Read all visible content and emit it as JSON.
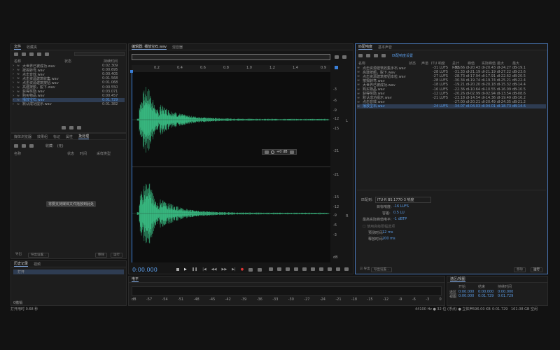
{
  "files_panel": {
    "tabs": [
      "文件",
      "收藏夹"
    ],
    "columns": [
      "名称",
      "状态",
      "持续时间"
    ],
    "files": [
      {
        "name": "大世界已被成功.wav",
        "duration": "0:02.309"
      },
      {
        "name": "按揭转弯.wav",
        "duration": "0:00.695"
      },
      {
        "name": "点击音效.wav",
        "duration": "0:00.405"
      },
      {
        "name": "点击资源建筑收集.wav",
        "duration": "0:01.568"
      },
      {
        "name": "点击资源建筑按钮.wav",
        "duration": "0:01.068"
      },
      {
        "name": "高建按额，脱下.wav",
        "duration": "0:00.550"
      },
      {
        "name": "获得奖励.wav",
        "duration": "0:03.071"
      },
      {
        "name": "购买物品.wav",
        "duration": "0:00.457"
      },
      {
        "name": "播放宝石.wav",
        "duration": "0:01.729",
        "selected": true
      },
      {
        "name": "默认成功提示.wav",
        "duration": "0:01.382"
      }
    ]
  },
  "browser_panel": {
    "tabs": [
      "媒体浏览器",
      "效果组",
      "标记",
      "属性",
      "批处理"
    ],
    "collection_label": "收藏:",
    "collection_value": "(无)",
    "columns": [
      "名称",
      "状态",
      "时间",
      "采样类型"
    ],
    "drop_hint": "将要支持媒体文件拖放到此处",
    "bottom_left": [
      "导出",
      "导出设置..."
    ],
    "bottom_right": [
      "移除",
      "运行"
    ]
  },
  "history_panel": {
    "tabs": [
      "历史记录",
      "视频"
    ],
    "items": [
      "打开"
    ],
    "status": "0撤销"
  },
  "editor": {
    "tabs": [
      "编辑器: 播放宝石.wav",
      "混音器"
    ],
    "ruler": [
      "0.2",
      "0.4",
      "0.6",
      "0.8",
      "1.0",
      "1.2",
      "1.4"
    ],
    "ruler_end": "0.9",
    "db_ticks": [
      "-3",
      "-6",
      "-9",
      "-12",
      "-15",
      "-21",
      "-21",
      "-15",
      "-12",
      "-9",
      "-6",
      "-3",
      "dB"
    ],
    "hud_gain": "+0 dB",
    "time_display": "0:00.000",
    "channel_left": "L",
    "channel_right": "R"
  },
  "levels": {
    "title": "电平",
    "scale": [
      "dB",
      "-57",
      "-54",
      "-51",
      "-48",
      "-45",
      "-42",
      "-39",
      "-36",
      "-33",
      "-30",
      "-27",
      "-24",
      "-21",
      "-18",
      "-15",
      "-12",
      "-9",
      "-6",
      "-3",
      "0"
    ]
  },
  "match_panel": {
    "tabs": [
      "匹配响度",
      "基本声音"
    ],
    "settings_link": "匹配响度设置",
    "columns": [
      "名称",
      "状态",
      " 声道",
      "ITU 响度",
      "总计 RMS",
      "峰值",
      "实际峰值",
      "最大",
      "最大"
    ],
    "rows": [
      {
        "name": "点击资源建筑收集手石.wav",
        "itu": "-31 LUFS",
        "rms": "-32.66 dB",
        "peak": "-20.43 dB",
        "tpeak": "-20.43 dB",
        "m1": "-24.27 dB",
        "m2": "-19.1"
      },
      {
        "name": "高建按额，脱下.wav",
        "itu": "-28 LUFS",
        "rms": "-31.33 dB",
        "peak": "-21.19 dB",
        "tpeak": "-21.19 dB",
        "m1": "-27.22 dB",
        "m2": "-23.6"
      },
      {
        "name": "点击资源建筑按钮本粒.wav",
        "itu": "-27 LUFS",
        "rms": "-28.73 dB",
        "peak": "-17.94 dB",
        "tpeak": "-17.91 dB",
        "m1": "-22.62 dB",
        "m2": "-20.5"
      },
      {
        "name": "按揭转弯.wav",
        "itu": "-28 LUFS",
        "rms": "-30.34 dB",
        "peak": "-19.74 dB",
        "tpeak": "-19.74 dB",
        "m1": "-25.21 dB",
        "m2": "-22.4"
      },
      {
        "name": "大世界已被成功.wav",
        "itu": "-18 LUFS",
        "rms": "-19.21 dB",
        "peak": "-20.20 dB",
        "tpeak": "-20.18 dB",
        "m1": "-15.32 dB",
        "m2": "-14.4"
      },
      {
        "name": "购买物品.wav",
        "itu": "-16 LUFS",
        "rms": "-22.36 dB",
        "peak": "-10.64 dB",
        "tpeak": "-10.55 dB",
        "m1": "-16.09 dB",
        "m2": "-10.5"
      },
      {
        "name": "获得奖励.wav",
        "itu": "-12 LUFS",
        "rms": "-20.26 dB",
        "peak": "-02.99 dB",
        "tpeak": "-02.94 dB",
        "m1": "-13.54 dB",
        "m2": "-08.6"
      },
      {
        "name": "默认成功提示.wav",
        "itu": "-21 LUFS",
        "rms": "-23.18 dB",
        "peak": "-14.54 dB",
        "tpeak": "-14.36 dB",
        "m1": "-19.49 dB",
        "m2": "-16.2"
      },
      {
        "name": "点击音效.wav",
        "itu": "",
        "rms": "-27.00 dB",
        "peak": "-20.21 dB",
        "tpeak": "-20.49 dB",
        "m1": "-24.35 dB",
        "m2": "-21.2"
      },
      {
        "name": "播放宝石.wav",
        "itu": "-24 LUFS",
        "rms": "-34.07 dB",
        "peak": "-04.03 dB",
        "tpeak": "-04.01 dB",
        "m1": "-18.73 dB",
        "m2": "-14.6",
        "selected": true
      }
    ],
    "settings": {
      "mode_label": "匹配到:",
      "mode_value": "ITU-R BS.1770-3 响度",
      "target_label": "目标响度:",
      "target_value": "-16 LUFS",
      "tolerance_label": "容差:",
      "tolerance_value": "0.5 LU",
      "max_peak_label": "最高实际峰值电平:",
      "max_peak_value": "-1 dBTP",
      "limiter_label": "使用高级限幅选项",
      "lookahead_label": "预测时间:",
      "lookahead_value": "12 ms",
      "release_label": "释放时间:",
      "release_value": "200 ms",
      "export_label": "导出",
      "export_settings": "导出设置...",
      "remove": "移除",
      "run": "运行"
    }
  },
  "selection_panel": {
    "title": "选区/视图",
    "columns": [
      "开始",
      "结束",
      "持续时间"
    ],
    "rows": [
      {
        "label": "选区",
        "start": "0:00.000",
        "end": "0:00.000",
        "dur": "0:00.000"
      },
      {
        "label": "视图",
        "start": "0:00.000",
        "end": "0:01.729",
        "dur": "0:01.729"
      }
    ]
  },
  "status_bar": {
    "left": "打开用时 0.68 秒",
    "items": [
      "44100 Hz ● 32 位 (浮点) ● 立体声",
      "596.00 KB",
      "0:01.729",
      "161.08 GB 空闲"
    ]
  },
  "colors": {
    "waveform": "#3ecf8e",
    "accent": "#5a9be6",
    "playhead": "#3a7fd8"
  }
}
